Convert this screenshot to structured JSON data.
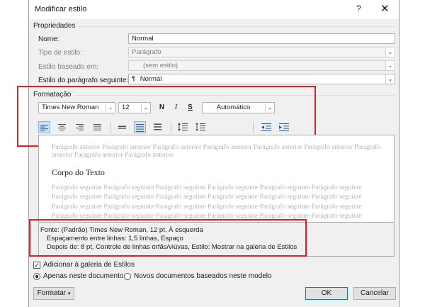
{
  "window": {
    "title": "Modificar estilo",
    "help_glyph": "?",
    "close_glyph": "✕"
  },
  "properties": {
    "heading": "Propriedades",
    "name_label": "Nome:",
    "name_value": "Normal",
    "type_label": "Tipo de estilo:",
    "type_value": "Parágrafo",
    "based_label": "Estilo baseado em:",
    "based_value": "(sem estilo)",
    "next_label": "Estilo do parágrafo seguinte:",
    "next_value": "Normal"
  },
  "formatting": {
    "heading": "Formatação",
    "font": "Times New Roman",
    "size": "12",
    "bold": "N",
    "italic": "I",
    "underline": "S",
    "color": "Automático"
  },
  "preview": {
    "prev_para": "Parágrafo anterior Parágrafo anterior Parágrafo anterior Parágrafo anterior Parágrafo anterior Parágrafo anterior Parágrafo anterior Parágrafo anterior Parágrafo anterior",
    "body": "Corpo do Texto",
    "next_para": "Parágrafo seguinte Parágrafo seguinte Parágrafo seguinte Parágrafo seguinte Parágrafo seguinte Parágrafo seguinte Parágrafo seguinte Parágrafo seguinte Parágrafo seguinte Parágrafo seguinte Parágrafo seguinte Parágrafo seguinte Parágrafo seguinte Parágrafo seguinte Parágrafo seguinte Parágrafo seguinte Parágrafo seguinte Parágrafo seguinte Parágrafo seguinte Parágrafo seguinte Parágrafo seguinte Parágrafo seguinte Parágrafo seguinte Parágrafo seguinte"
  },
  "description": {
    "line1": "Fonte: (Padrão) Times New Roman, 12 pt, À esquerda",
    "line2": "Espaçamento entre linhas:  1,5 linhas, Espaço",
    "line3": "Depois de:  8 pt, Controle de linhas órfãs/viúvas, Estilo: Mostrar na galeria de Estilos"
  },
  "options": {
    "add_gallery": "Adicionar à galeria de Estilos",
    "only_doc": "Apenas neste documento",
    "new_docs": "Novos documentos baseados neste modelo"
  },
  "buttons": {
    "format": "Formatar",
    "ok": "OK",
    "cancel": "Cancelar"
  },
  "colors": {
    "highlight_frame": "#dd2020",
    "active_button": "#cde4f7"
  }
}
